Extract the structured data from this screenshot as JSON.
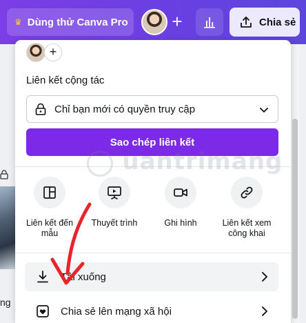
{
  "topbar": {
    "try_pro_label": "Dùng thử Canva Pro",
    "share_label": "Chia sẻ",
    "plus": "+"
  },
  "background": {
    "text_fragment": "ng"
  },
  "panel": {
    "plus": "+",
    "collab_label": "Liên kết cộng tác",
    "access_value": "Chỉ bạn mới có quyền truy cập",
    "copy_link_label": "Sao chép liên kết",
    "options": [
      {
        "label": "Liên kết đến mẫu",
        "icon": "template-icon"
      },
      {
        "label": "Thuyết trình",
        "icon": "present-icon"
      },
      {
        "label": "Ghi hình",
        "icon": "record-icon"
      },
      {
        "label": "Liên kết xem công khai",
        "icon": "link-icon"
      }
    ],
    "rows": [
      {
        "label": "Tải xuống",
        "icon": "download-icon"
      },
      {
        "label": "Chia sẻ lên mạng xã hội",
        "icon": "heart-icon"
      }
    ]
  },
  "watermark": "uantrimang",
  "colors": {
    "accent": "#7d2ae8",
    "topbar_start": "#7c3ee6",
    "topbar_end": "#5b46dc",
    "annotation_arrow": "#e8232a"
  }
}
